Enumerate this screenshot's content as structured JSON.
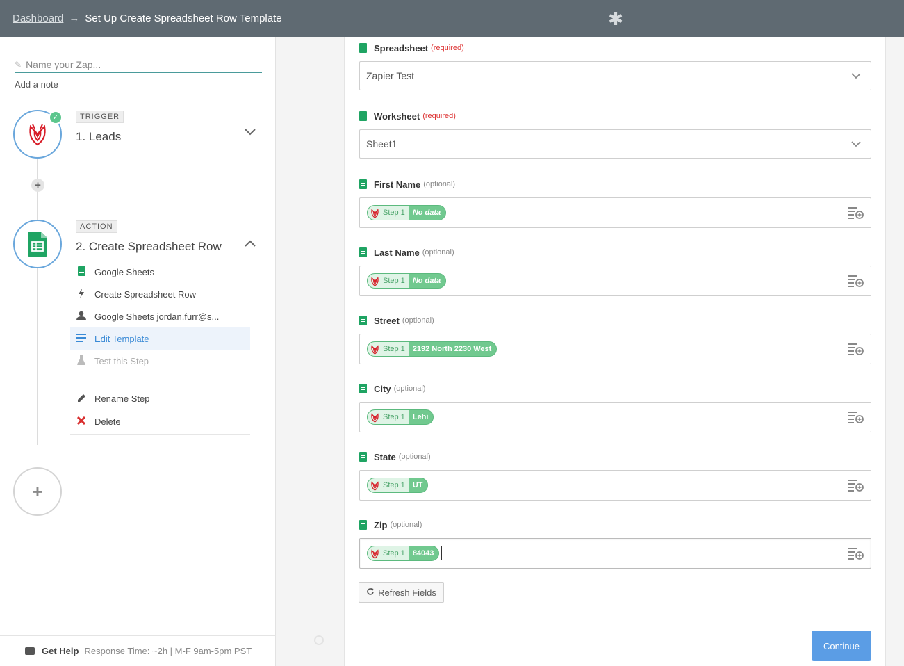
{
  "header": {
    "breadcrumb_link": "Dashboard",
    "breadcrumb_separator": "→",
    "title": "Set Up Create Spreadsheet Row Template",
    "logo_icon": "zapier-asterisk-icon"
  },
  "sidebar": {
    "zap_name_placeholder": "Name your Zap...",
    "add_note": "Add a note",
    "trigger": {
      "tag": "TRIGGER",
      "title": "1. Leads",
      "app_icon": "leads-app-icon",
      "status_icon": "check-icon"
    },
    "action": {
      "tag": "ACTION",
      "title": "2. Create Spreadsheet Row",
      "app_icon": "google-sheets-icon",
      "substeps": [
        {
          "label": "Google Sheets",
          "icon": "google-sheets-icon"
        },
        {
          "label": "Create Spreadsheet Row",
          "icon": "bolt-icon"
        },
        {
          "label": "Google Sheets jordan.furr@s...",
          "icon": "user-icon"
        },
        {
          "label": "Edit Template",
          "icon": "list-icon"
        },
        {
          "label": "Test this Step",
          "icon": "flask-icon"
        }
      ],
      "actions": [
        {
          "label": "Rename Step",
          "icon": "pencil-icon"
        },
        {
          "label": "Delete",
          "icon": "delete-x-icon",
          "color": "#d93030"
        }
      ]
    },
    "help": {
      "label": "Get Help",
      "response": "Response Time: ~2h | M-F 9am-5pm PST"
    }
  },
  "form": {
    "fields": [
      {
        "label": "Spreadsheet",
        "qualifier": "(required)",
        "type": "select",
        "value": "Zapier Test"
      },
      {
        "label": "Worksheet",
        "qualifier": "(required)",
        "type": "select",
        "value": "Sheet1"
      },
      {
        "label": "First Name",
        "qualifier": "(optional)",
        "type": "mapped",
        "step": "Step 1",
        "value": "No data"
      },
      {
        "label": "Last Name",
        "qualifier": "(optional)",
        "type": "mapped",
        "step": "Step 1",
        "value": "No data"
      },
      {
        "label": "Street",
        "qualifier": "(optional)",
        "type": "mapped",
        "step": "Step 1",
        "value": "2192 North 2230 West"
      },
      {
        "label": "City",
        "qualifier": "(optional)",
        "type": "mapped",
        "step": "Step 1",
        "value": "Lehi"
      },
      {
        "label": "State",
        "qualifier": "(optional)",
        "type": "mapped",
        "step": "Step 1",
        "value": "UT"
      },
      {
        "label": "Zip",
        "qualifier": "(optional)",
        "type": "mapped",
        "step": "Step 1",
        "value": "84043"
      }
    ],
    "refresh_label": "Refresh Fields",
    "continue_label": "Continue"
  },
  "colors": {
    "topbar": "#5f6a72",
    "accent_blue": "#5b9de5",
    "pill_green": "#71c98f",
    "sheets_green": "#1fa463",
    "required_red": "#dd3333"
  }
}
